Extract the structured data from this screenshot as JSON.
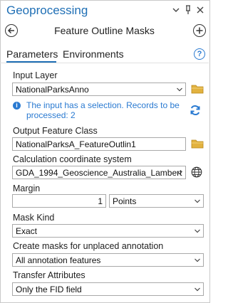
{
  "window": {
    "title": "Geoprocessing",
    "menu_icon": "chevron-down-icon",
    "pin_icon": "pin-icon",
    "close_icon": "close-icon"
  },
  "tool": {
    "title": "Feature Outline Masks"
  },
  "tabs": [
    {
      "label": "Parameters",
      "active": true
    },
    {
      "label": "Environments",
      "active": false
    }
  ],
  "params": {
    "input_layer": {
      "label": "Input Layer",
      "value": "NationalParksAnno"
    },
    "info_message": "The input has a selection. Records to be processed: 2",
    "output_fc": {
      "label": "Output Feature Class",
      "value": "NationalParksA_FeatureOutlin1"
    },
    "coord_sys": {
      "label": "Calculation coordinate system",
      "value": "GDA_1994_Geoscience_Australia_Lambert"
    },
    "margin": {
      "label": "Margin",
      "value": "1",
      "units": "Points"
    },
    "mask_kind": {
      "label": "Mask Kind",
      "value": "Exact"
    },
    "unplaced": {
      "label": "Create masks for unplaced annotation",
      "value": "All annotation features"
    },
    "transfer": {
      "label": "Transfer Attributes",
      "value": "Only the FID field"
    }
  },
  "colors": {
    "accent": "#1f6fb5",
    "info": "#2a7ad1",
    "folder": "#e2b23f",
    "refresh": "#2a7ad1"
  }
}
